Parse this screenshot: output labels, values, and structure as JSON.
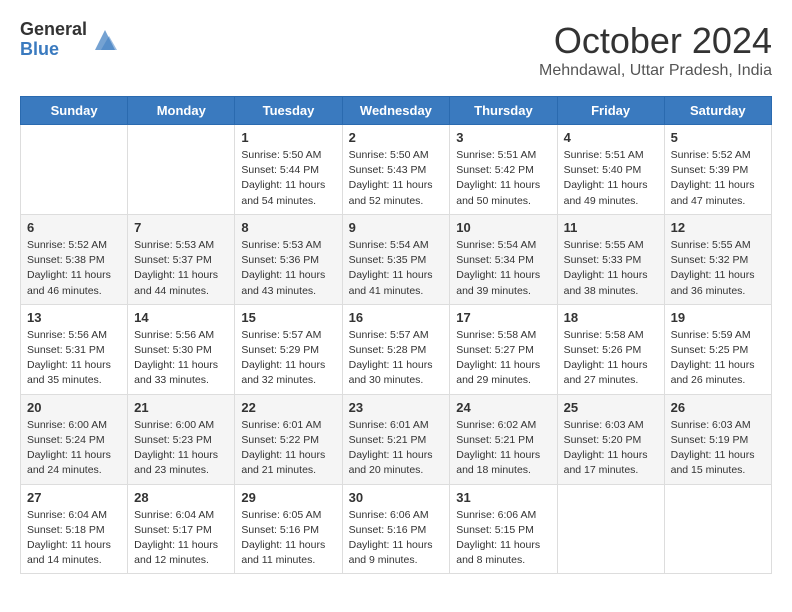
{
  "header": {
    "logo_general": "General",
    "logo_blue": "Blue",
    "title": "October 2024",
    "location": "Mehndawal, Uttar Pradesh, India"
  },
  "days_of_week": [
    "Sunday",
    "Monday",
    "Tuesday",
    "Wednesday",
    "Thursday",
    "Friday",
    "Saturday"
  ],
  "weeks": [
    [
      {
        "day": "",
        "info": ""
      },
      {
        "day": "",
        "info": ""
      },
      {
        "day": "1",
        "info": "Sunrise: 5:50 AM\nSunset: 5:44 PM\nDaylight: 11 hours and 54 minutes."
      },
      {
        "day": "2",
        "info": "Sunrise: 5:50 AM\nSunset: 5:43 PM\nDaylight: 11 hours and 52 minutes."
      },
      {
        "day": "3",
        "info": "Sunrise: 5:51 AM\nSunset: 5:42 PM\nDaylight: 11 hours and 50 minutes."
      },
      {
        "day": "4",
        "info": "Sunrise: 5:51 AM\nSunset: 5:40 PM\nDaylight: 11 hours and 49 minutes."
      },
      {
        "day": "5",
        "info": "Sunrise: 5:52 AM\nSunset: 5:39 PM\nDaylight: 11 hours and 47 minutes."
      }
    ],
    [
      {
        "day": "6",
        "info": "Sunrise: 5:52 AM\nSunset: 5:38 PM\nDaylight: 11 hours and 46 minutes."
      },
      {
        "day": "7",
        "info": "Sunrise: 5:53 AM\nSunset: 5:37 PM\nDaylight: 11 hours and 44 minutes."
      },
      {
        "day": "8",
        "info": "Sunrise: 5:53 AM\nSunset: 5:36 PM\nDaylight: 11 hours and 43 minutes."
      },
      {
        "day": "9",
        "info": "Sunrise: 5:54 AM\nSunset: 5:35 PM\nDaylight: 11 hours and 41 minutes."
      },
      {
        "day": "10",
        "info": "Sunrise: 5:54 AM\nSunset: 5:34 PM\nDaylight: 11 hours and 39 minutes."
      },
      {
        "day": "11",
        "info": "Sunrise: 5:55 AM\nSunset: 5:33 PM\nDaylight: 11 hours and 38 minutes."
      },
      {
        "day": "12",
        "info": "Sunrise: 5:55 AM\nSunset: 5:32 PM\nDaylight: 11 hours and 36 minutes."
      }
    ],
    [
      {
        "day": "13",
        "info": "Sunrise: 5:56 AM\nSunset: 5:31 PM\nDaylight: 11 hours and 35 minutes."
      },
      {
        "day": "14",
        "info": "Sunrise: 5:56 AM\nSunset: 5:30 PM\nDaylight: 11 hours and 33 minutes."
      },
      {
        "day": "15",
        "info": "Sunrise: 5:57 AM\nSunset: 5:29 PM\nDaylight: 11 hours and 32 minutes."
      },
      {
        "day": "16",
        "info": "Sunrise: 5:57 AM\nSunset: 5:28 PM\nDaylight: 11 hours and 30 minutes."
      },
      {
        "day": "17",
        "info": "Sunrise: 5:58 AM\nSunset: 5:27 PM\nDaylight: 11 hours and 29 minutes."
      },
      {
        "day": "18",
        "info": "Sunrise: 5:58 AM\nSunset: 5:26 PM\nDaylight: 11 hours and 27 minutes."
      },
      {
        "day": "19",
        "info": "Sunrise: 5:59 AM\nSunset: 5:25 PM\nDaylight: 11 hours and 26 minutes."
      }
    ],
    [
      {
        "day": "20",
        "info": "Sunrise: 6:00 AM\nSunset: 5:24 PM\nDaylight: 11 hours and 24 minutes."
      },
      {
        "day": "21",
        "info": "Sunrise: 6:00 AM\nSunset: 5:23 PM\nDaylight: 11 hours and 23 minutes."
      },
      {
        "day": "22",
        "info": "Sunrise: 6:01 AM\nSunset: 5:22 PM\nDaylight: 11 hours and 21 minutes."
      },
      {
        "day": "23",
        "info": "Sunrise: 6:01 AM\nSunset: 5:21 PM\nDaylight: 11 hours and 20 minutes."
      },
      {
        "day": "24",
        "info": "Sunrise: 6:02 AM\nSunset: 5:21 PM\nDaylight: 11 hours and 18 minutes."
      },
      {
        "day": "25",
        "info": "Sunrise: 6:03 AM\nSunset: 5:20 PM\nDaylight: 11 hours and 17 minutes."
      },
      {
        "day": "26",
        "info": "Sunrise: 6:03 AM\nSunset: 5:19 PM\nDaylight: 11 hours and 15 minutes."
      }
    ],
    [
      {
        "day": "27",
        "info": "Sunrise: 6:04 AM\nSunset: 5:18 PM\nDaylight: 11 hours and 14 minutes."
      },
      {
        "day": "28",
        "info": "Sunrise: 6:04 AM\nSunset: 5:17 PM\nDaylight: 11 hours and 12 minutes."
      },
      {
        "day": "29",
        "info": "Sunrise: 6:05 AM\nSunset: 5:16 PM\nDaylight: 11 hours and 11 minutes."
      },
      {
        "day": "30",
        "info": "Sunrise: 6:06 AM\nSunset: 5:16 PM\nDaylight: 11 hours and 9 minutes."
      },
      {
        "day": "31",
        "info": "Sunrise: 6:06 AM\nSunset: 5:15 PM\nDaylight: 11 hours and 8 minutes."
      },
      {
        "day": "",
        "info": ""
      },
      {
        "day": "",
        "info": ""
      }
    ]
  ]
}
